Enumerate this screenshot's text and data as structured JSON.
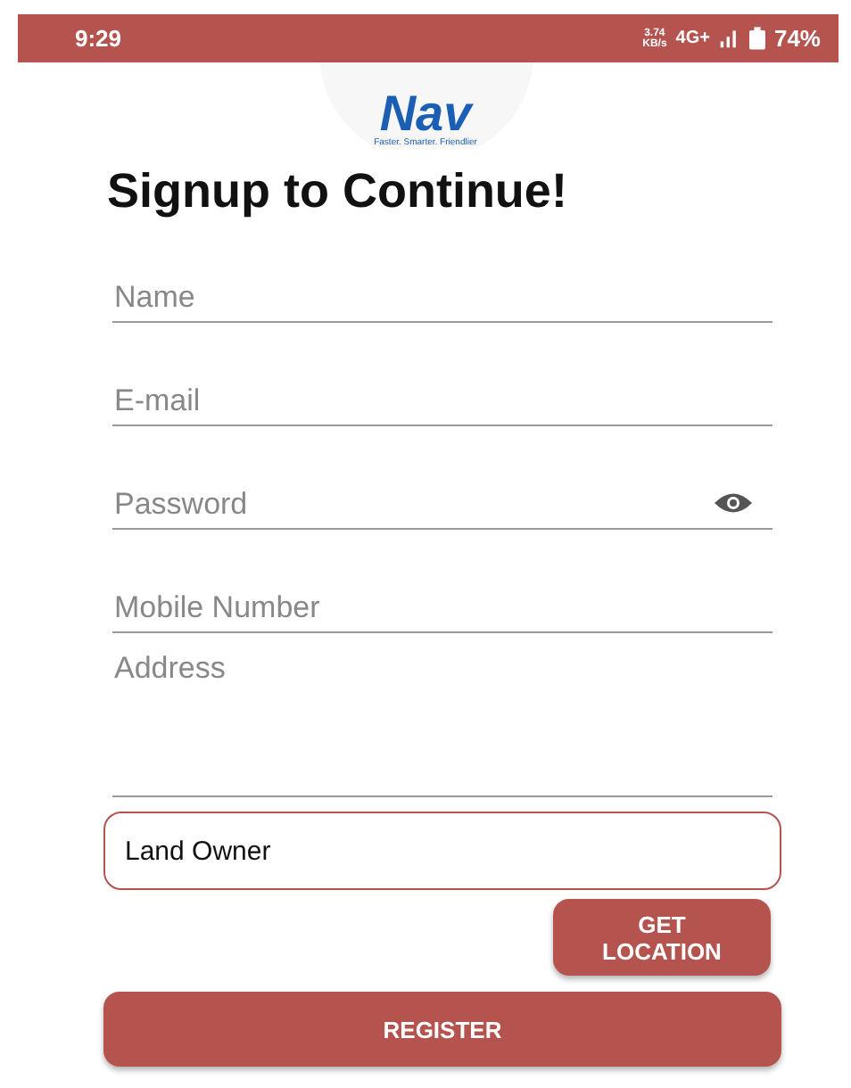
{
  "status_bar": {
    "time": "9:29",
    "network_speed": "3.74",
    "speed_unit": "KB/s",
    "network": "4G+",
    "battery": "74%"
  },
  "logo": {
    "text": "Nav",
    "tagline": "Faster. Smarter. Friendlier"
  },
  "title": "Signup to Continue!",
  "fields": [
    {
      "kind": "text",
      "placeholder": "Name"
    },
    {
      "kind": "text",
      "placeholder": "E-mail"
    },
    {
      "kind": "password",
      "placeholder": "Password"
    },
    {
      "kind": "text",
      "placeholder": "Mobile Number"
    },
    {
      "kind": "multiline",
      "placeholder": "Address"
    }
  ],
  "role_field": {
    "value": "Land Owner"
  },
  "buttons": [
    {
      "kind": "small",
      "label": "GET\nLOCATION"
    },
    {
      "kind": "wide",
      "label": "REGISTER"
    }
  ]
}
